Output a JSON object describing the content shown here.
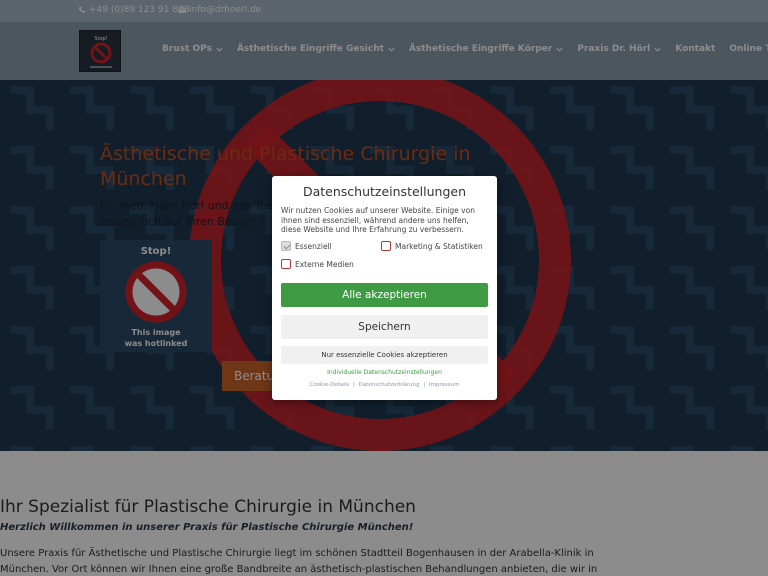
{
  "topbar": {
    "phone": "+49 (0)89 123 91 888",
    "email": "info@drhoerl.de"
  },
  "logo": {
    "alt": "Dr. Hörl Logo",
    "text": "Stop!"
  },
  "nav": {
    "items": [
      {
        "label": "Brust OPs",
        "has_submenu": true
      },
      {
        "label": "Ästhetische Eingriffe Gesicht",
        "has_submenu": true
      },
      {
        "label": "Ästhetische Eingriffe Körper",
        "has_submenu": true
      },
      {
        "label": "Praxis Dr. Hörl",
        "has_submenu": true
      },
      {
        "label": "Kontakt",
        "has_submenu": false
      },
      {
        "label": "Online Termin",
        "has_submenu": false
      }
    ]
  },
  "hero": {
    "title": "Ästhetische und Plastische Chirurgie in München",
    "subtitle": "Dr. med. Hans Hörl und das Team freuen sich auf Ihren Besuch",
    "hotlink_stop": "Stop!",
    "hotlink_text_line1": "This image",
    "hotlink_text_line2": "was hotlinked",
    "cta_label": "Beratungstermin"
  },
  "modal": {
    "title": "Datenschutzeinstellungen",
    "description": "Wir nutzen Cookies auf unserer Website. Einige von ihnen sind essenziell, während andere uns helfen, diese Website und Ihre Erfahrung zu verbessern.",
    "checkboxes": {
      "essential": {
        "label": "Essenziell",
        "checked": true
      },
      "marketing": {
        "label": "Marketing & Statistiken",
        "checked": false
      },
      "external": {
        "label": "Externe Medien",
        "checked": false
      }
    },
    "accept_all": "Alle akzeptieren",
    "save": "Speichern",
    "essential_only": "Nur essenzielle Cookies akzeptieren",
    "individual": "Individuelle Datenschutzeinstellungen",
    "footer": {
      "cookie_details": "Cookie-Details",
      "privacy": "Datenschutzerklärung",
      "imprint": "Impressum"
    }
  },
  "content": {
    "heading": "Ihr Spezialist für Plastische Chirurgie in München",
    "welcome": "Herzlich Willkommen in unserer Praxis für Plastische Chirurgie München!",
    "body": "Unsere Praxis für Ästhetische und Plastische Chirurgie liegt im schönen Stadtteil Bogenhausen in der Arabella-Klinik in München. Vor Ort können wir Ihnen eine große Bandbreite an ästhetisch-plastischen Behandlungen anbieten, die wir in unseren Praxisräumen"
  },
  "colors": {
    "accent_orange": "#c2501f",
    "accept_green": "#3f9a44",
    "hero_blue": "#1f3a52",
    "stop_red": "#d0232a"
  }
}
